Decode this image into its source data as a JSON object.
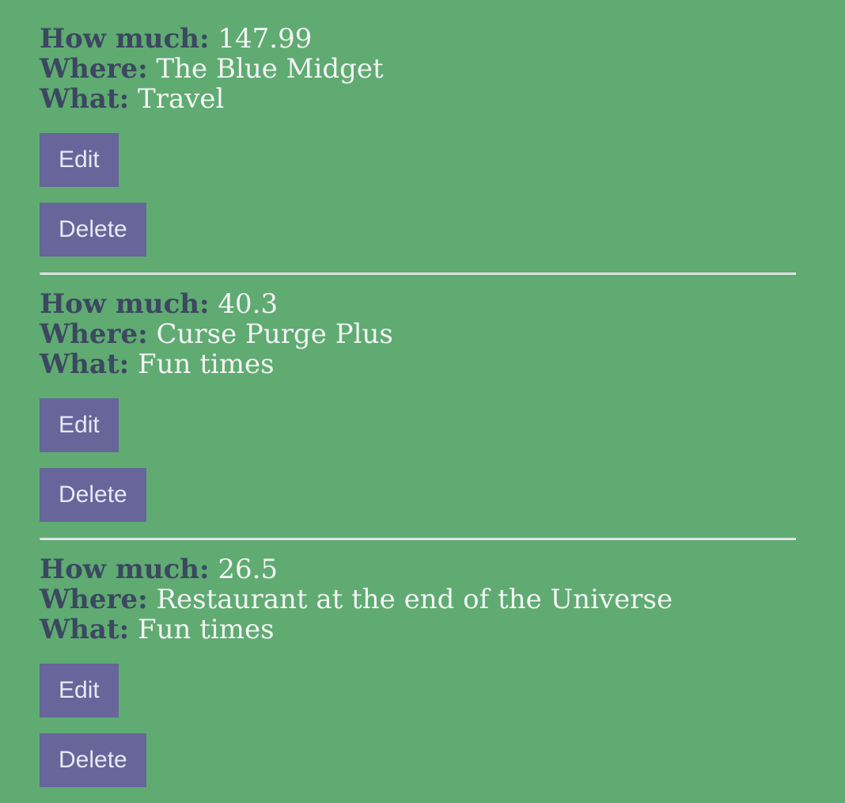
{
  "labels": {
    "how_much": "How much:",
    "where": "Where:",
    "what": "What:",
    "edit": "Edit",
    "delete": "Delete"
  },
  "entries": [
    {
      "amount": "147.99",
      "where": "The Blue Midget",
      "what": "Travel"
    },
    {
      "amount": "40.3",
      "where": "Curse Purge Plus",
      "what": "Fun times"
    },
    {
      "amount": "26.5",
      "where": "Restaurant at the end of the Universe",
      "what": "Fun times"
    }
  ],
  "colors": {
    "background": "#5fab72",
    "label": "#3c4760",
    "value": "#f4f4f4",
    "button": "#676599",
    "button_text": "#e9e8f5"
  }
}
